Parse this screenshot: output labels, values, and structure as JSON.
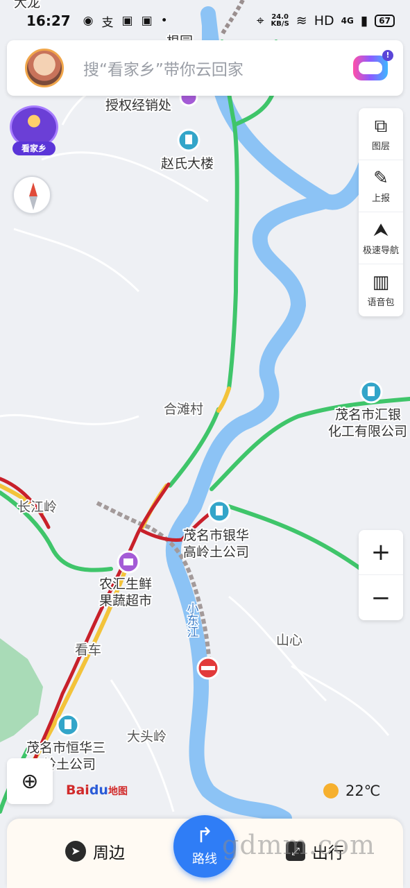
{
  "status_bar": {
    "time": "16:27",
    "icons": [
      "wechat-icon",
      "alipay-icon",
      "app-icon",
      "app-icon",
      "dot-icon"
    ],
    "net_speed": "24.0",
    "net_unit": "KB/S",
    "hd": "HD",
    "network": "4G",
    "battery": "67"
  },
  "search": {
    "placeholder": "搜“看家乡”带你云回家"
  },
  "kanjiaxiang": {
    "label": "看家乡"
  },
  "toolbar": {
    "items": [
      {
        "label": "图层",
        "icon": "layers-icon"
      },
      {
        "label": "上报",
        "icon": "report-edit-icon"
      },
      {
        "label": "极速导航",
        "icon": "navigation-arrow-icon"
      },
      {
        "label": "语音包",
        "icon": "voice-pack-icon"
      }
    ]
  },
  "zoom": {
    "in": "+",
    "out": "−"
  },
  "map_labels": {
    "top_left": "大龙",
    "top_center": "根园",
    "shouquan": "授权经销处",
    "zhaoshi": "赵氏大楼",
    "hetan": "合滩村",
    "huiyin_1": "茂名市汇银",
    "huiyin_2": "化工有限公司",
    "changjiang": "长江岭",
    "yinhua_1": "茂名市银华",
    "yinhua_2": "高岭土公司",
    "nonghui_1": "农汇生鲜",
    "nonghui_2": "果蔬超市",
    "xiaodong": "小东江",
    "shanxin": "山心",
    "kanche": "看车",
    "datou": "大头岭",
    "henghua_1": "茂名市恒华三",
    "henghua_2": "岭土公司"
  },
  "logo": {
    "bai": "Bai",
    "du": "du",
    "map": "地图"
  },
  "weather": {
    "temp": "22℃"
  },
  "bottom_bar": {
    "nearby": "周边",
    "route": "路线",
    "travel": "出行"
  },
  "watermark": "gdmm.com",
  "colors": {
    "map_bg": "#eef0f4",
    "river": "#8cc3f5",
    "road_green": "#3fc56a",
    "road_yellow": "#f3c33a",
    "road_red": "#c8202a",
    "accent_blue": "#2f7df6",
    "poi_teal": "#33a5c9",
    "poi_purple": "#a45bd6"
  }
}
